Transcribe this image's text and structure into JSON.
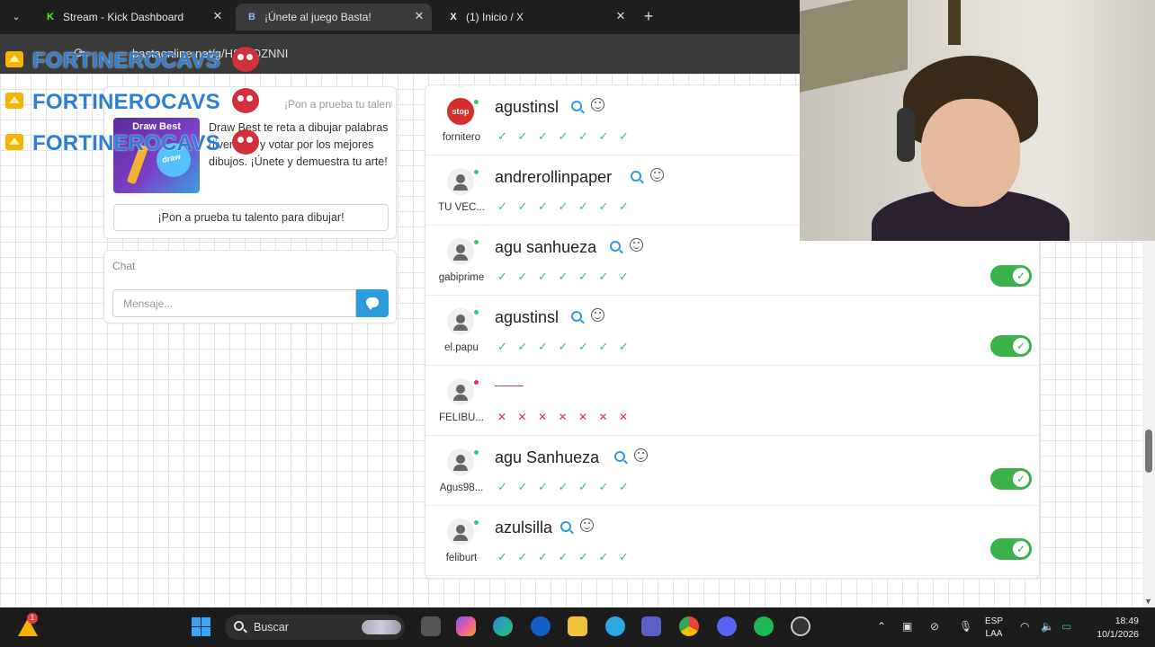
{
  "browser": {
    "tabs": [
      {
        "label": "Stream - Kick Dashboard",
        "favicon": "K",
        "favicon_color": "#53fc18",
        "active": false
      },
      {
        "label": "¡Únete al juego Basta!",
        "favicon": "B",
        "favicon_color": "#8ab4f8",
        "active": true
      },
      {
        "label": "(1) Inicio / X",
        "favicon": "X",
        "favicon_color": "#ffffff",
        "active": false
      }
    ],
    "close_glyph": "✕",
    "new_tab_glyph": "+",
    "url": "bastaonline.net/g/HSAIQZNNI"
  },
  "overlay": {
    "names": [
      "FORTINEROCAVS",
      "FORTINEROCAVS",
      "FORTINEROCAVS"
    ],
    "name_color": "#2d7fd6"
  },
  "promo": {
    "header": "¡Pon a prueba tu talento para dibujar!",
    "image_title": "Draw Best",
    "image_tag": "draw",
    "description": "Draw Best te reta a dibujar palabras divertidas y votar por los mejores dibujos. ¡Únete y demuestra tu arte!",
    "button_label": "¡Pon a prueba tu talento para dibujar!"
  },
  "chat": {
    "title": "Chat",
    "placeholder": "Mensaje..."
  },
  "players": [
    {
      "name": "agustinsl",
      "tag": "fornitero",
      "avatar": "stop",
      "online": true,
      "marks": [
        "ok",
        "ok",
        "ok",
        "ok",
        "ok",
        "ok",
        "ok"
      ],
      "toggle": false
    },
    {
      "name": "andrerollinpaper",
      "tag": "TU VEC...",
      "avatar": "default",
      "online": true,
      "marks": [
        "ok",
        "ok",
        "ok",
        "ok",
        "ok",
        "ok",
        "ok"
      ],
      "toggle": false
    },
    {
      "name": "agu sanhueza",
      "tag": "gabiprime",
      "avatar": "default",
      "online": true,
      "marks": [
        "ok",
        "ok",
        "ok",
        "ok",
        "ok",
        "ok",
        "ok"
      ],
      "toggle": true
    },
    {
      "name": "agustinsl",
      "tag": "el.papu",
      "avatar": "default",
      "online": true,
      "marks": [
        "ok",
        "ok",
        "ok",
        "ok",
        "ok",
        "ok",
        "ok"
      ],
      "toggle": true
    },
    {
      "name": "",
      "tag": "FELIBU...",
      "avatar": "default",
      "online": false,
      "marks": [
        "bad",
        "bad",
        "bad",
        "bad",
        "bad",
        "bad",
        "bad"
      ],
      "toggle": false
    },
    {
      "name": "agu Sanhueza",
      "tag": "Agus98...",
      "avatar": "default",
      "online": true,
      "marks": [
        "ok",
        "ok",
        "ok",
        "ok",
        "ok",
        "ok",
        "ok"
      ],
      "toggle": true
    },
    {
      "name": "azulsilla",
      "tag": "feliburt",
      "avatar": "default",
      "online": true,
      "marks": [
        "ok",
        "ok",
        "ok",
        "ok",
        "ok",
        "ok",
        "ok"
      ],
      "toggle": true
    }
  ],
  "glyphs": {
    "ok": "✓",
    "bad": "✕",
    "toggle_on": "✓"
  },
  "taskbar": {
    "warn_badge": "1",
    "search_label": "Buscar",
    "lang_top": "ESP",
    "lang_bottom": "LAA",
    "time": "18:49",
    "date": "10/1/2026"
  },
  "colors": {
    "accent": "#2d9cdb",
    "ok": "#3cc060",
    "bad": "#e0314f",
    "toggle": "#3cb34a"
  }
}
